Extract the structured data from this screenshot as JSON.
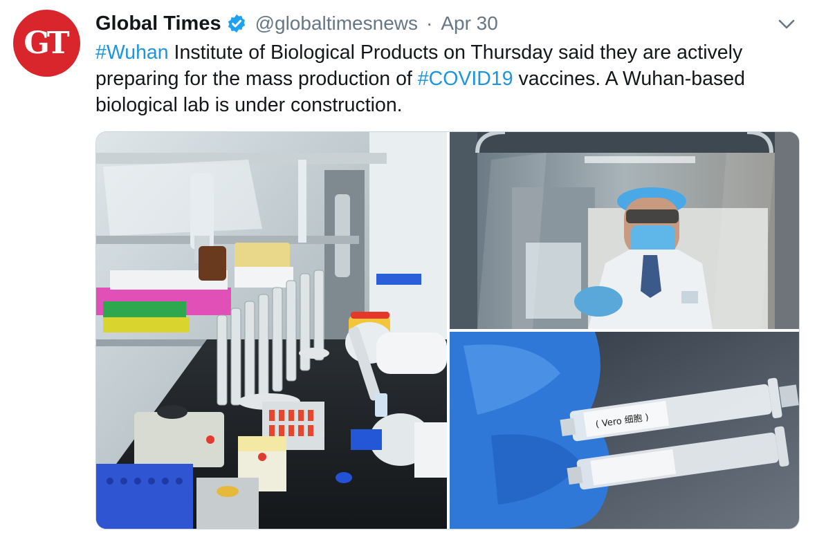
{
  "tweet": {
    "avatar_text": "GT",
    "display_name": "Global Times",
    "handle": "@globaltimesnews",
    "separator": "·",
    "date": "Apr 30",
    "hashtag_1": "#Wuhan",
    "text_1": " Institute of Biological Products on Thursday said they are actively preparing for the mass production of ",
    "hashtag_2": "#COVID19",
    "text_2": " vaccines. A Wuhan-based biological lab is under construction.",
    "icons": [
      "verified-badge-icon",
      "chevron-down-icon"
    ]
  },
  "media": {
    "syringe_label": "( Vero 细胞 )"
  },
  "colors": {
    "brand_red": "#d8262c",
    "link_blue": "#1b95e0",
    "muted_gray": "#657786",
    "verified_blue": "#1da1f2"
  }
}
